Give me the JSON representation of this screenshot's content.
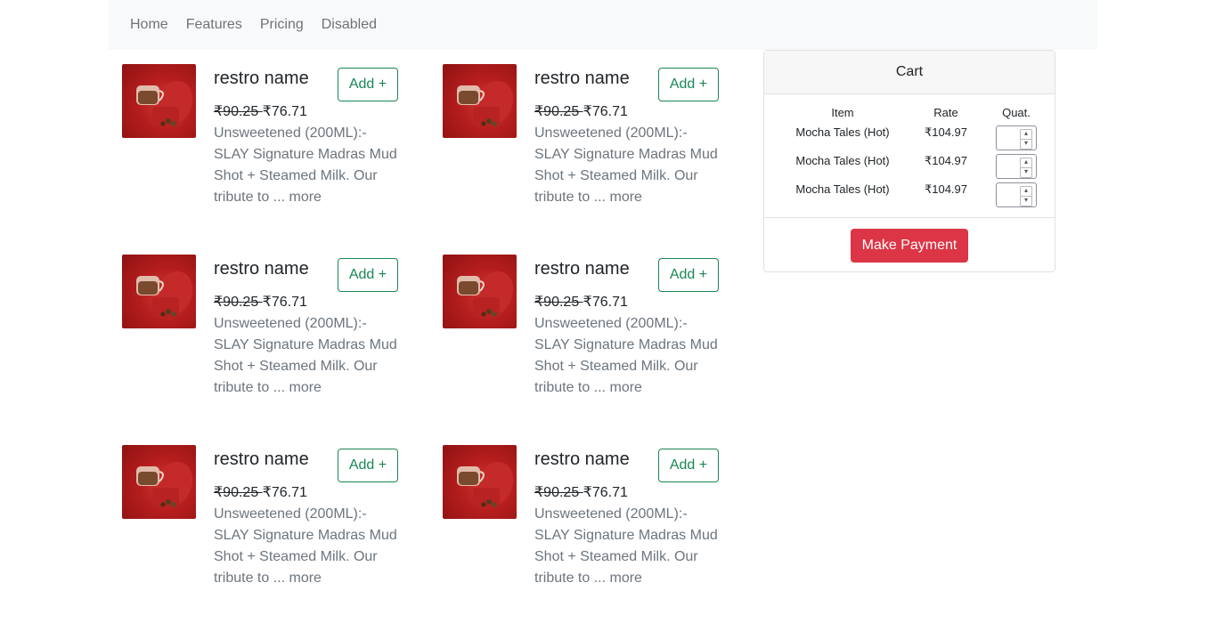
{
  "navbar": {
    "links": [
      "Home",
      "Features",
      "Pricing",
      "Disabled"
    ]
  },
  "products": [
    {
      "title": "restro name",
      "add_label": "Add +",
      "old_price": "₹90.25 ",
      "new_price": "₹76.71",
      "description": "Unsweetened (200ML):- SLAY Signature Madras Mud Shot + Steamed Milk. Our tribute to ...",
      "more_label": "more",
      "image": "mocha-cup-image"
    },
    {
      "title": "restro name",
      "add_label": "Add +",
      "old_price": "₹90.25 ",
      "new_price": "₹76.71",
      "description": "Unsweetened (200ML):- SLAY Signature Madras Mud Shot + Steamed Milk. Our tribute to ...",
      "more_label": "more",
      "image": "mocha-cup-image"
    },
    {
      "title": "restro name",
      "add_label": "Add +",
      "old_price": "₹90.25 ",
      "new_price": "₹76.71",
      "description": "Unsweetened (200ML):- SLAY Signature Madras Mud Shot + Steamed Milk. Our tribute to ...",
      "more_label": "more",
      "image": "mocha-cup-image"
    },
    {
      "title": "restro name",
      "add_label": "Add +",
      "old_price": "₹90.25 ",
      "new_price": "₹76.71",
      "description": "Unsweetened (200ML):- SLAY Signature Madras Mud Shot + Steamed Milk. Our tribute to ...",
      "more_label": "more",
      "image": "mocha-cup-image"
    },
    {
      "title": "restro name",
      "add_label": "Add +",
      "old_price": "₹90.25 ",
      "new_price": "₹76.71",
      "description": "Unsweetened (200ML):- SLAY Signature Madras Mud Shot + Steamed Milk. Our tribute to ...",
      "more_label": "more",
      "image": "mocha-cup-image"
    },
    {
      "title": "restro name",
      "add_label": "Add +",
      "old_price": "₹90.25 ",
      "new_price": "₹76.71",
      "description": "Unsweetened (200ML):- SLAY Signature Madras Mud Shot + Steamed Milk. Our tribute to ...",
      "more_label": "more",
      "image": "mocha-cup-image"
    }
  ],
  "cart": {
    "title": "Cart",
    "headers": {
      "item": "Item",
      "rate": "Rate",
      "qty": "Quat."
    },
    "rows": [
      {
        "item": "Mocha Tales (Hot)",
        "rate": "₹104.97",
        "qty": ""
      },
      {
        "item": "Mocha Tales (Hot)",
        "rate": "₹104.97",
        "qty": ""
      },
      {
        "item": "Mocha Tales (Hot)",
        "rate": "₹104.97",
        "qty": ""
      }
    ],
    "pay_label": "Make Payment"
  },
  "colors": {
    "navbar_bg": "#f8f9fa",
    "success": "#198754",
    "danger": "#dc3545",
    "muted": "#6c757d"
  }
}
